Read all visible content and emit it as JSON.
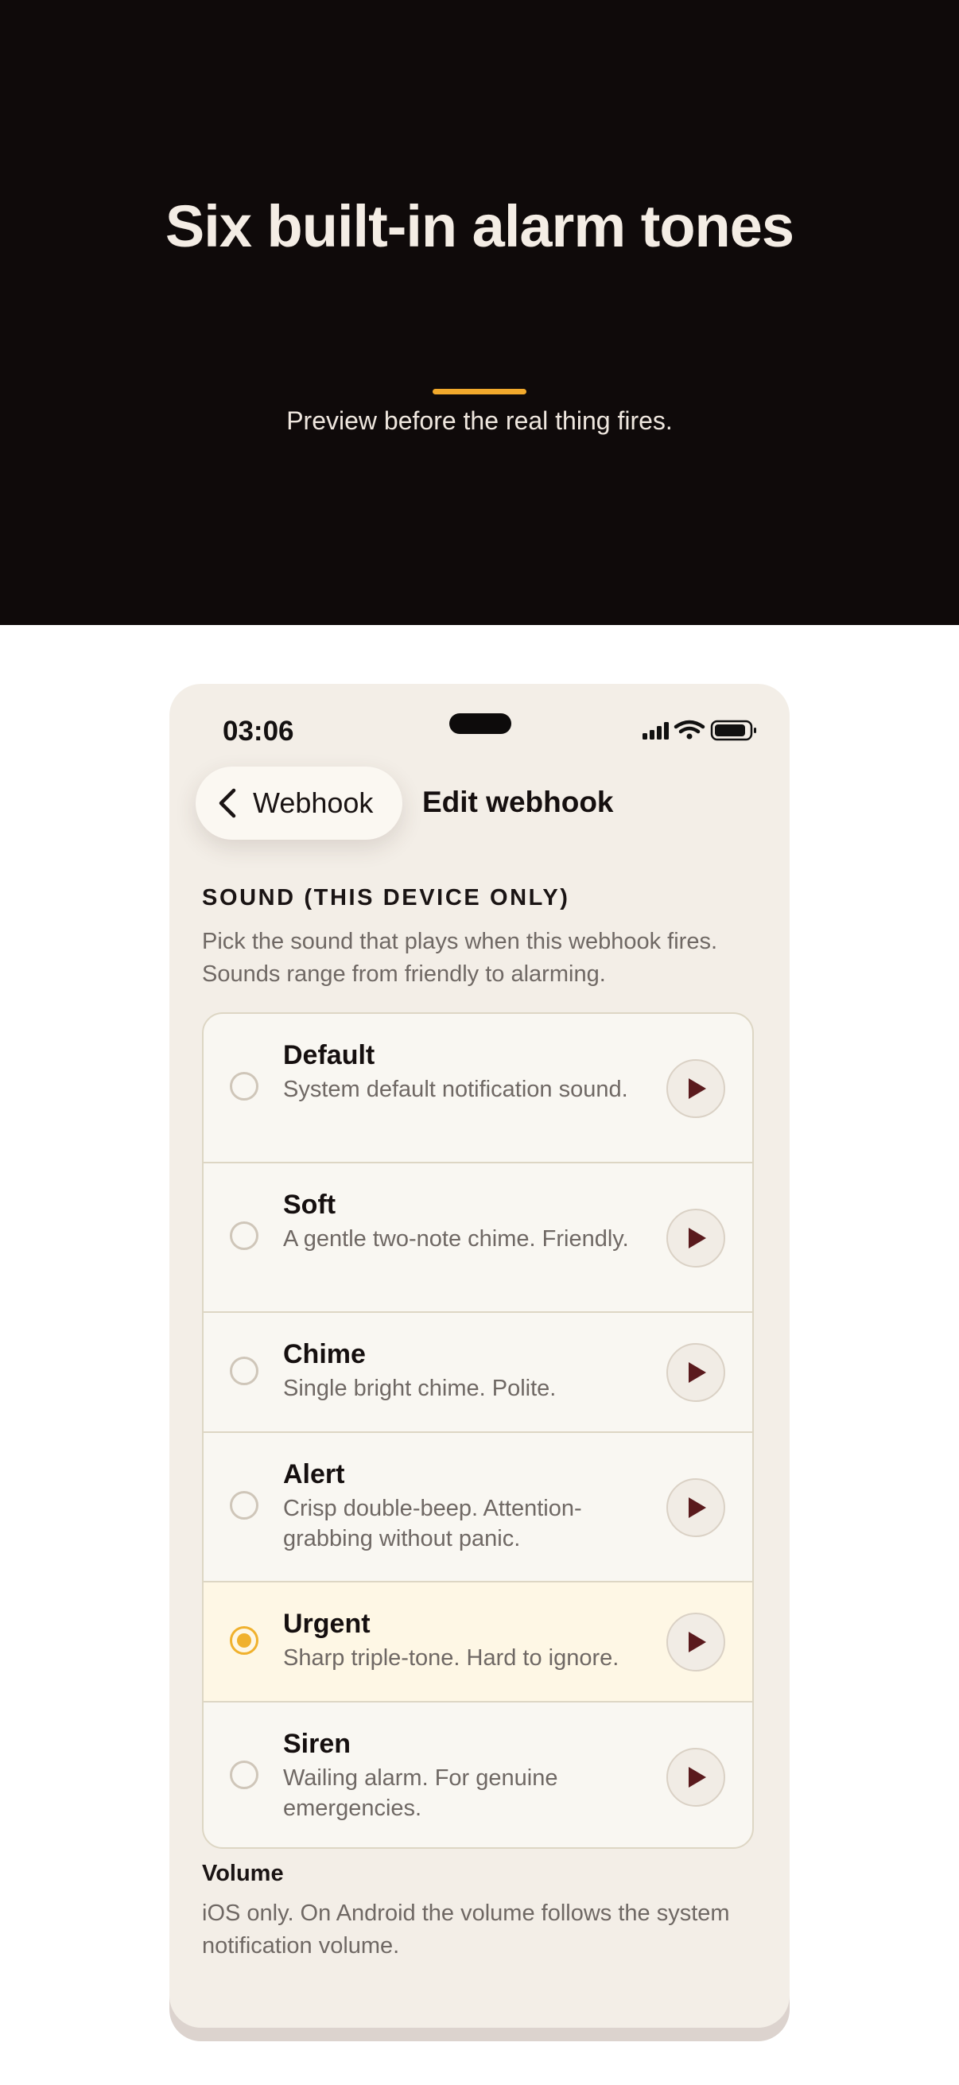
{
  "hero": {
    "title": "Six built-in alarm tones",
    "subtitle": "Preview before the real thing fires.",
    "accent_color": "#f1a92c"
  },
  "status_bar": {
    "time": "03:06",
    "icons": [
      "signal-icon",
      "wifi-icon",
      "battery-icon"
    ]
  },
  "nav": {
    "back_label": "Webhook",
    "title": "Edit webhook"
  },
  "sound_section": {
    "heading": "SOUND (THIS DEVICE ONLY)",
    "description": "Pick the sound that plays when this webhook fires. Sounds range from friendly to alarming.",
    "selected": "Urgent",
    "options": [
      {
        "title": "Default",
        "description": "System default notification sound."
      },
      {
        "title": "Soft",
        "description": "A gentle two-note chime. Friendly."
      },
      {
        "title": "Chime",
        "description": "Single bright chime. Polite."
      },
      {
        "title": "Alert",
        "description": "Crisp double-beep. Attention-grabbing without panic."
      },
      {
        "title": "Urgent",
        "description": "Sharp triple-tone. Hard to ignore."
      },
      {
        "title": "Siren",
        "description": "Wailing alarm. For genuine emergencies."
      }
    ]
  },
  "volume": {
    "label": "Volume",
    "description": "iOS only. On Android the volume follows the system notification volume."
  },
  "colors": {
    "selected_accent": "#f0b12d",
    "play_glyph": "#5a1a1d"
  }
}
